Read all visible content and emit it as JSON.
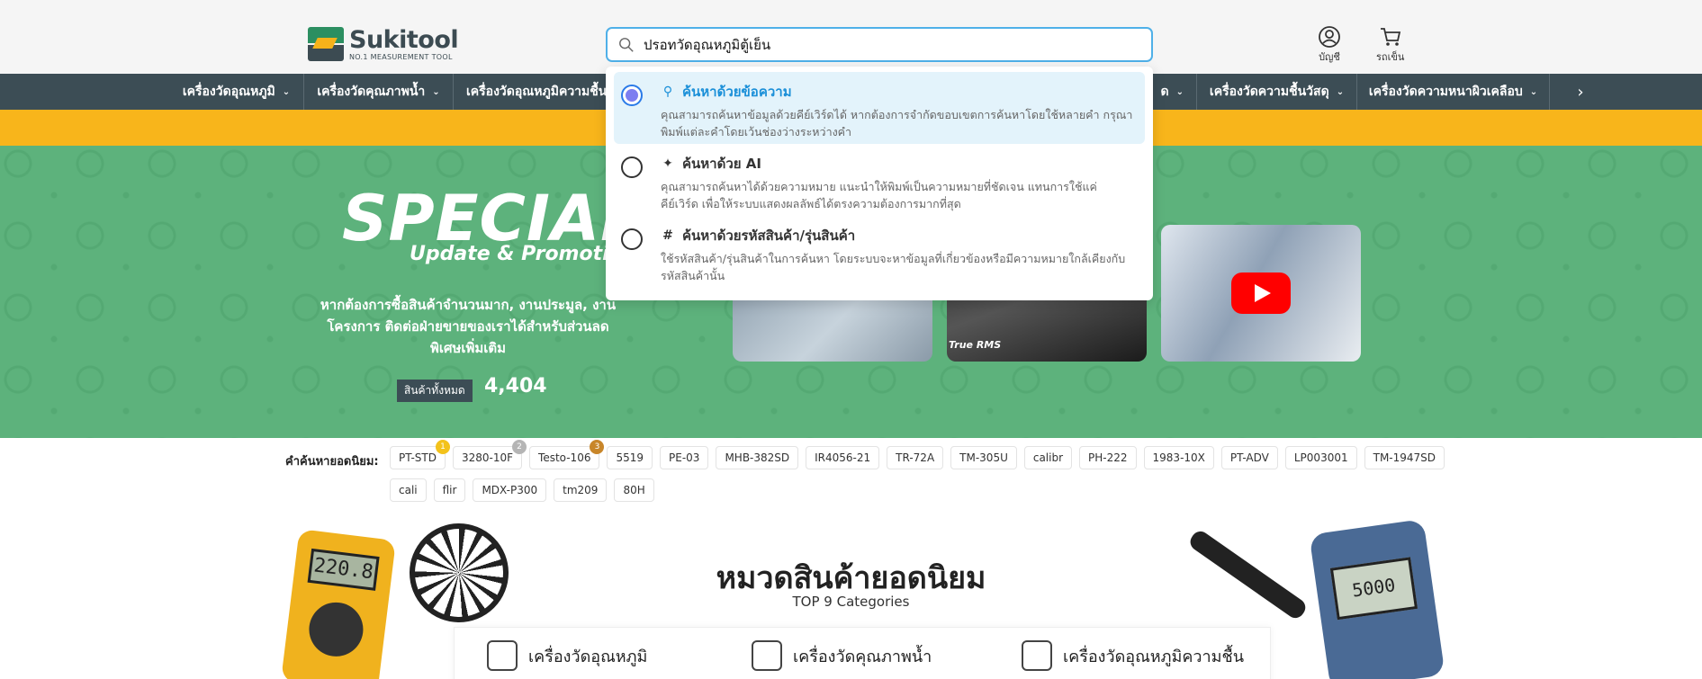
{
  "header": {
    "logo_name": "Sukitool",
    "logo_tagline": "NO.1 MEASUREMENT TOOL",
    "search_value": "ปรอทวัดอุณหภูมิตู้เย็น",
    "account_label": "บัญชี",
    "cart_label": "รถเข็น"
  },
  "nav": {
    "items": [
      "เครื่องวัดอุณหภูมิ",
      "เครื่องวัดคุณภาพน้ำ",
      "เครื่องวัดอุณหภูมิความชื้น",
      "ด",
      "เครื่องวัดความชื้นวัสดุ",
      "เครื่องวัดความหนาผิวเคลือบ"
    ]
  },
  "search_dropdown": {
    "options": [
      {
        "title": "ค้นหาด้วยข้อความ",
        "desc": "คุณสามารถค้นหาข้อมูลด้วยคีย์เวิร์ดได้ หากต้องการจำกัดขอบเขตการค้นหาโดยใช้หลายคำ กรุณาพิมพ์แต่ละคำโดยเว้นช่องว่างระหว่างคำ",
        "icon": "key-icon",
        "selected": true
      },
      {
        "title": "ค้นหาด้วย AI",
        "desc": "คุณสามารถค้นหาได้ด้วยความหมาย แนะนำให้พิมพ์เป็นความหมายที่ชัดเจน แทนการใช้แค่คีย์เวิร์ด เพื่อให้ระบบแสดงผลลัพธ์ได้ตรงความต้องการมากที่สุด",
        "icon": "sparkle-icon",
        "selected": false
      },
      {
        "title": "ค้นหาด้วยรหัสสินค้า/รุ่นสินค้า",
        "desc": "ใช้รหัสสินค้า/รุ่นสินค้าในการค้นหา โดยระบบจะหาข้อมูลที่เกี่ยวข้องหรือมีความหมายใกล้เคียงกับรหัสสินค้านั้น",
        "icon": "hash-icon",
        "selected": false
      }
    ]
  },
  "banner": {
    "special": "SPECIAL",
    "update": "Update & Promotic",
    "desc": "หากต้องการซื้อสินค้าจำนวนมาก, งานประมูล, งานโครงการ ติดต่อฝ่ายขายของเราได้สำหรับส่วนลดพิเศษเพิ่มเติม",
    "all_label": "สินค้าทั้งหมด",
    "all_count": "4,404",
    "video_text": "True RMS"
  },
  "popular": {
    "label": "คำค้นหายอดนิยม:",
    "keywords": [
      {
        "text": "PT-STD",
        "badge": "1",
        "badge_color": "#f3c21b"
      },
      {
        "text": "3280-10F",
        "badge": "2",
        "badge_color": "#b5b5b5"
      },
      {
        "text": "Testo-106",
        "badge": "3",
        "badge_color": "#c8862a"
      },
      {
        "text": "5519"
      },
      {
        "text": "PE-03"
      },
      {
        "text": "MHB-382SD"
      },
      {
        "text": "IR4056-21"
      },
      {
        "text": "TR-72A"
      },
      {
        "text": "TM-305U"
      },
      {
        "text": "calibr"
      },
      {
        "text": "PH-222"
      },
      {
        "text": "1983-10X"
      },
      {
        "text": "PT-ADV"
      },
      {
        "text": "LP003001"
      },
      {
        "text": "TM-1947SD"
      },
      {
        "text": "cali"
      },
      {
        "text": "flir"
      },
      {
        "text": "MDX-P300"
      },
      {
        "text": "tm209"
      },
      {
        "text": "80H"
      }
    ]
  },
  "categories": {
    "title": "หมวดสินค้ายอดนิยม",
    "subtitle": "TOP 9 Categories",
    "items": [
      "เครื่องวัดอุณหภูมิ",
      "เครื่องวัดคุณภาพน้ำ",
      "เครื่องวัดอุณหภูมิความชื้น"
    ]
  },
  "products": {
    "meter_display": "220.8",
    "probe_display": "5000"
  },
  "colors": {
    "nav_bg": "#3c4d55",
    "accent_yellow": "#f8b51b",
    "banner_green": "#5db27c",
    "search_border": "#4fb0e8"
  }
}
